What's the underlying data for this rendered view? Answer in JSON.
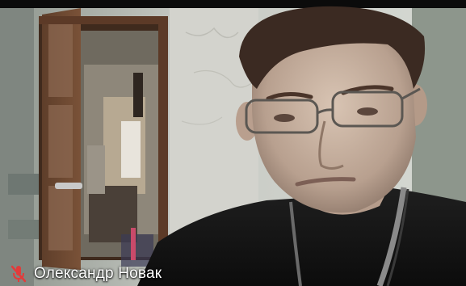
{
  "participant": {
    "name": "Олександр Новак",
    "mic_status_icon": "microphone-muted-icon",
    "mic_color": "#e23b3b"
  }
}
